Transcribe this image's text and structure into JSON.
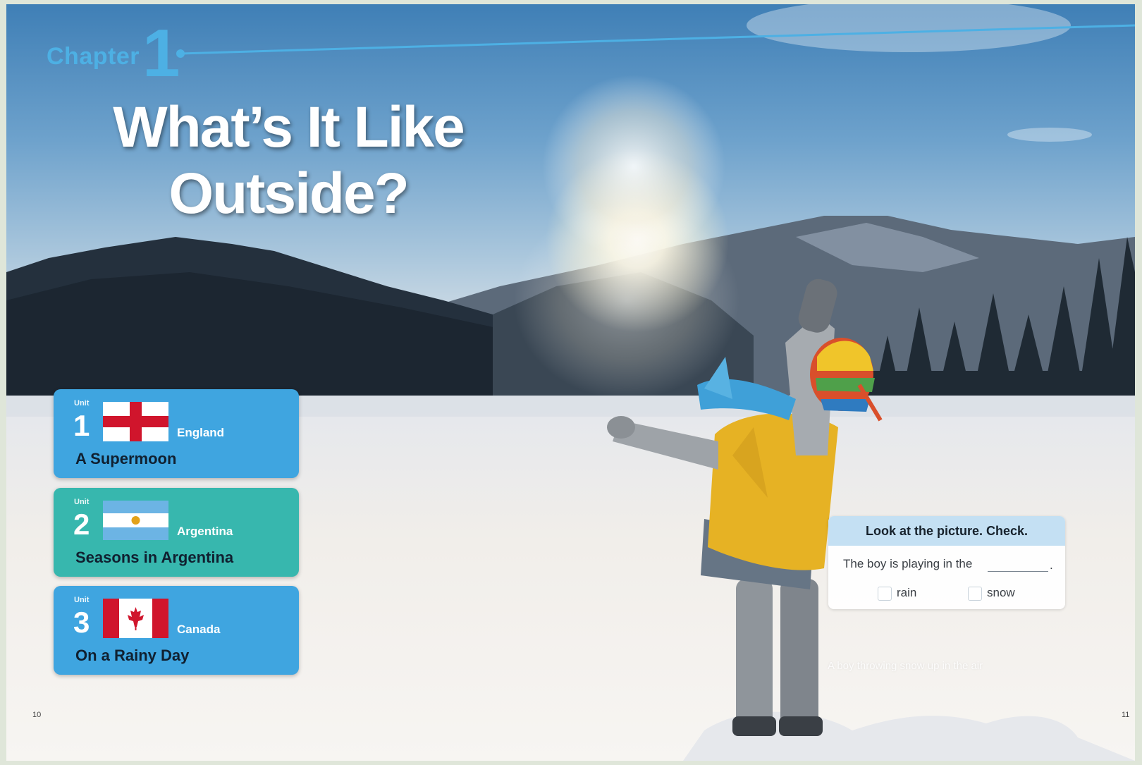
{
  "chapter": {
    "label": "Chapter",
    "number": "1"
  },
  "title": {
    "line1": "What’s It Like",
    "line2": "Outside?"
  },
  "units": [
    {
      "tag": "Unit",
      "number": "1",
      "country": "England",
      "title": "A Supermoon",
      "color": "#3fa5e0",
      "flag": "england-flag-icon"
    },
    {
      "tag": "Unit",
      "number": "2",
      "country": "Argentina",
      "title": "Seasons in Argentina",
      "color": "#37b7ae",
      "flag": "argentina-flag-icon"
    },
    {
      "tag": "Unit",
      "number": "3",
      "country": "Canada",
      "title": "On a Rainy Day",
      "color": "#3fa5e0",
      "flag": "canada-flag-icon"
    }
  ],
  "quiz": {
    "heading": "Look at the picture. Check.",
    "question": "The boy is playing in the",
    "end": ".",
    "options": [
      "rain",
      "snow"
    ]
  },
  "caption": "A boy throwing snow up in the air",
  "pages": {
    "left": "10",
    "right": "11"
  },
  "colors": {
    "chapter_accent": "#4db0e4",
    "unit_blue": "#3fa5e0",
    "unit_teal": "#37b7ae",
    "jacket": "#e8b424"
  }
}
